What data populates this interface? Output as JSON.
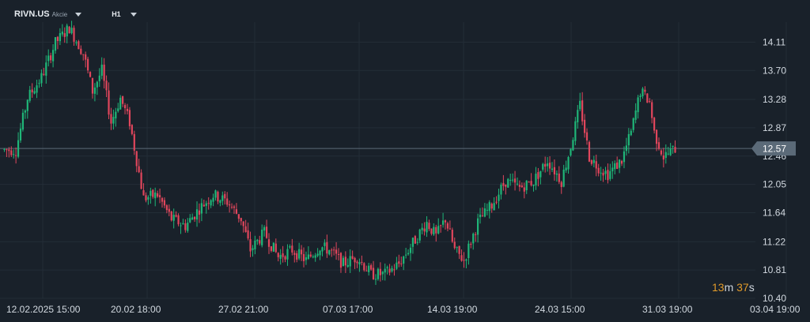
{
  "header": {
    "symbol": "RIVN.US",
    "symbol_type": "Akcie",
    "timeframe": "H1",
    "symbol_dropdown_icon": "caret-down-icon",
    "timeframe_dropdown_icon": "caret-down-icon"
  },
  "countdown": {
    "minutes": "13",
    "minutes_unit": "m",
    "seconds": "37",
    "seconds_unit": "s"
  },
  "colors": {
    "background": "#19212a",
    "up": "#1fb678",
    "down": "#e0465c",
    "grid": "#232d37",
    "price_line": "#5d6b78",
    "price_tag": "#5b6a78"
  },
  "chart_data": {
    "type": "candlestick",
    "title": "",
    "ylim": [
      10.4,
      14.4
    ],
    "y_ticks": [
      "14.11",
      "13.70",
      "13.28",
      "12.87",
      "12.46",
      "12.05",
      "11.64",
      "11.22",
      "10.81",
      "10.40"
    ],
    "x_ticks": [
      "12.02.2025  15:00",
      "20.02  18:00",
      "27.02  21:00",
      "07.03  17:00",
      "14.03  19:00",
      "24.03  15:00",
      "31.03  19:00",
      "03.04  19:00"
    ],
    "last_price": "12.57",
    "grid": true,
    "close_path": [
      [
        0,
        12.55
      ],
      [
        5,
        12.55
      ],
      [
        10,
        13.3
      ],
      [
        16,
        13.6
      ],
      [
        22,
        14.1
      ],
      [
        28,
        14.32
      ],
      [
        34,
        13.95
      ],
      [
        38,
        13.4
      ],
      [
        42,
        13.7
      ],
      [
        46,
        12.95
      ],
      [
        50,
        13.3
      ],
      [
        54,
        12.95
      ],
      [
        60,
        11.85
      ],
      [
        66,
        11.9
      ],
      [
        72,
        11.55
      ],
      [
        78,
        11.45
      ],
      [
        84,
        11.7
      ],
      [
        90,
        11.9
      ],
      [
        96,
        11.8
      ],
      [
        102,
        11.55
      ],
      [
        106,
        11.1
      ],
      [
        112,
        11.35
      ],
      [
        118,
        11.0
      ],
      [
        124,
        11.1
      ],
      [
        130,
        10.95
      ],
      [
        136,
        11.15
      ],
      [
        140,
        11.1
      ],
      [
        146,
        10.9
      ],
      [
        152,
        11.0
      ],
      [
        158,
        10.75
      ],
      [
        164,
        10.75
      ],
      [
        170,
        10.9
      ],
      [
        176,
        11.2
      ],
      [
        182,
        11.5
      ],
      [
        186,
        11.3
      ],
      [
        190,
        11.55
      ],
      [
        194,
        11.1
      ],
      [
        198,
        10.95
      ],
      [
        204,
        11.5
      ],
      [
        210,
        11.75
      ],
      [
        216,
        12.1
      ],
      [
        222,
        12.0
      ],
      [
        228,
        12.1
      ],
      [
        234,
        12.4
      ],
      [
        240,
        12.1
      ],
      [
        244,
        12.6
      ],
      [
        248,
        13.2
      ],
      [
        252,
        12.45
      ],
      [
        256,
        12.3
      ],
      [
        260,
        12.2
      ],
      [
        266,
        12.4
      ],
      [
        270,
        12.8
      ],
      [
        274,
        13.4
      ],
      [
        278,
        13.25
      ],
      [
        280,
        12.8
      ],
      [
        284,
        12.45
      ],
      [
        289,
        12.57
      ]
    ],
    "candle_count": 290
  }
}
